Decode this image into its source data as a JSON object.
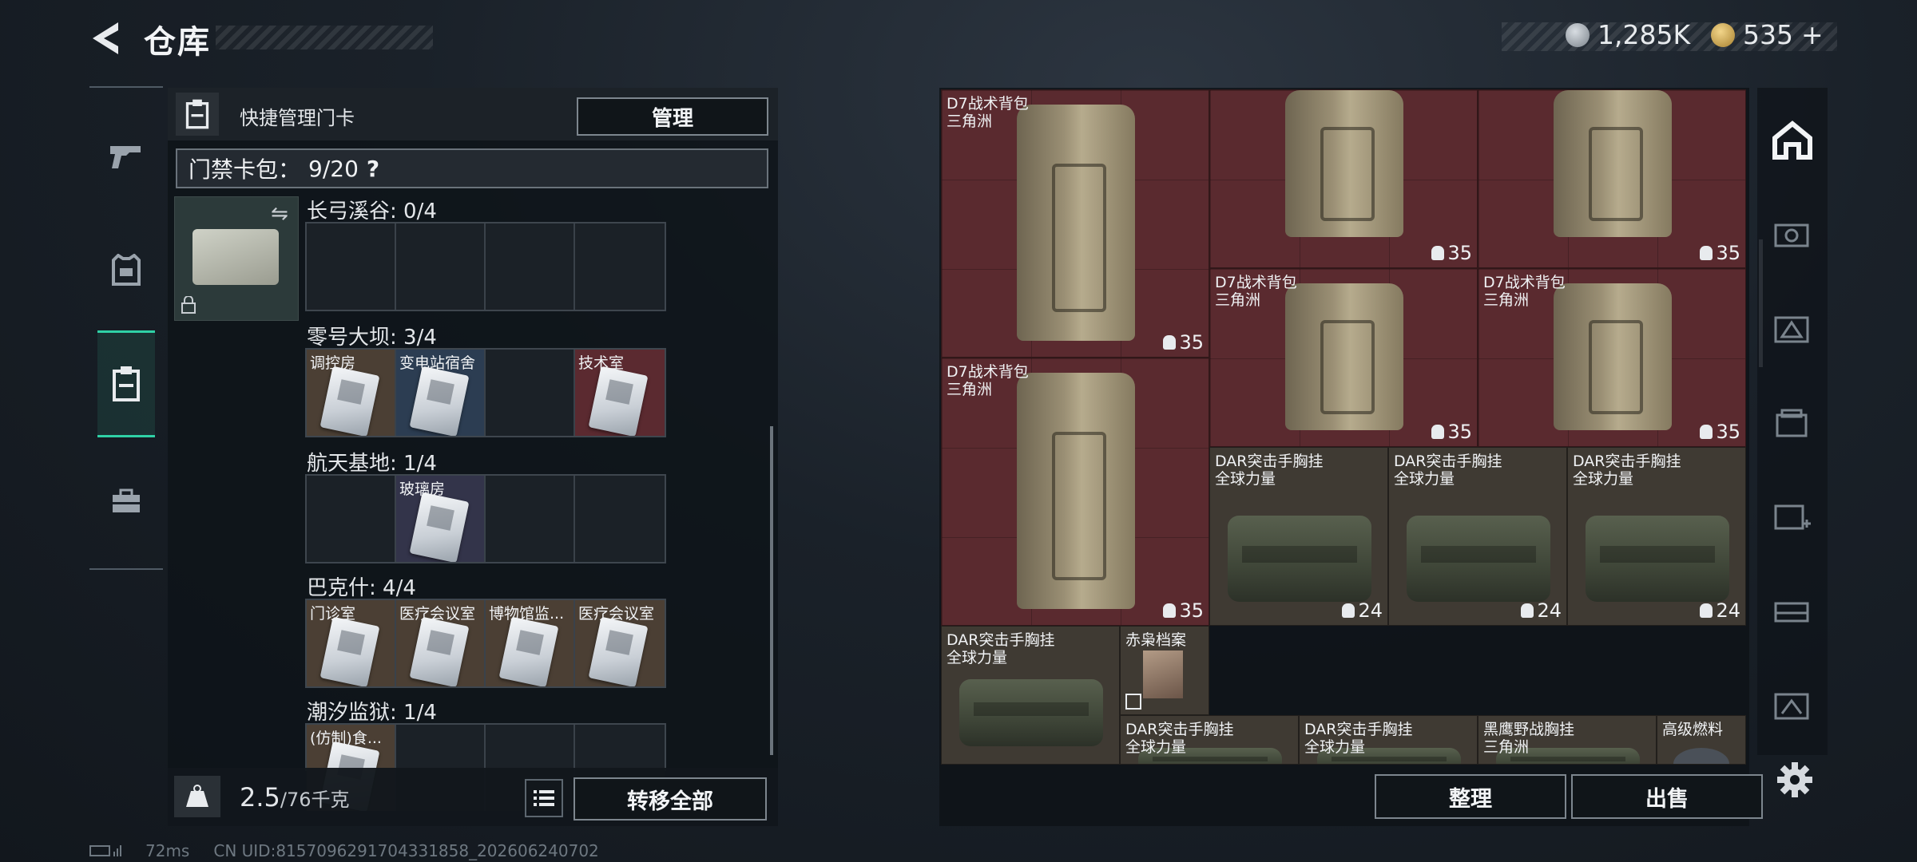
{
  "header": {
    "title": "仓库"
  },
  "currency": {
    "silver": "1,285K",
    "gold": "535",
    "gold_add": "+"
  },
  "left_nav": [
    "weapon-tab",
    "armor-tab",
    "keycard-tab",
    "toolbox-tab"
  ],
  "card_panel": {
    "quick_label": "快捷管理门卡",
    "manage_label": "管理",
    "keybag_label": "门禁卡包：",
    "keybag_count": "9/20",
    "keybag_help": "?",
    "maps": [
      {
        "title": "长弓溪谷: 0/4",
        "slots": [
          {
            "label": "",
            "color": "empty"
          },
          {
            "label": "",
            "color": "empty"
          },
          {
            "label": "",
            "color": "empty"
          },
          {
            "label": "",
            "color": "empty"
          }
        ]
      },
      {
        "title": "零号大坝: 3/4",
        "slots": [
          {
            "label": "调控房",
            "color": "beige"
          },
          {
            "label": "变电站宿舍",
            "color": "blue"
          },
          {
            "label": "",
            "color": "empty"
          },
          {
            "label": "技术室",
            "color": "red"
          }
        ]
      },
      {
        "title": "航天基地: 1/4",
        "slots": [
          {
            "label": "",
            "color": "empty"
          },
          {
            "label": "玻璃房",
            "color": "purple"
          },
          {
            "label": "",
            "color": "empty"
          },
          {
            "label": "",
            "color": "empty"
          }
        ]
      },
      {
        "title": "巴克什: 4/4",
        "slots": [
          {
            "label": "门诊室",
            "color": "beige"
          },
          {
            "label": "医疗会议室",
            "color": "beige"
          },
          {
            "label": "博物馆监...",
            "color": "beige"
          },
          {
            "label": "医疗会议室",
            "color": "beige"
          }
        ]
      },
      {
        "title": "潮汐监狱: 1/4",
        "slots": [
          {
            "label": "(仿制)食...",
            "color": "beige"
          },
          {
            "label": "",
            "color": "empty"
          },
          {
            "label": "",
            "color": "empty"
          },
          {
            "label": "",
            "color": "empty"
          }
        ]
      }
    ],
    "weight_value": "2.5",
    "weight_unit": "/76千克",
    "transfer_label": "转移全部"
  },
  "inventory": {
    "items": [
      {
        "name": "D7战术背包",
        "sub": "三角洲",
        "count": "35",
        "color": "red",
        "kind": "backpack",
        "show_name": true
      },
      {
        "name": "",
        "sub": "",
        "count": "35",
        "color": "red",
        "kind": "backpack",
        "show_name": false
      },
      {
        "name": "",
        "sub": "",
        "count": "35",
        "color": "red",
        "kind": "backpack",
        "show_name": false
      },
      {
        "name": "D7战术背包",
        "sub": "三角洲",
        "count": "35",
        "color": "red",
        "kind": "backpack",
        "show_name": true
      },
      {
        "name": "D7战术背包",
        "sub": "三角洲",
        "count": "35",
        "color": "red",
        "kind": "backpack",
        "show_name": true
      },
      {
        "name": "D7战术背包",
        "sub": "三角洲",
        "count": "35",
        "color": "red",
        "kind": "backpack",
        "show_name": true
      },
      {
        "name": "DAR突击手胸挂",
        "sub": "全球力量",
        "count": "24",
        "color": "beige",
        "kind": "rig",
        "show_name": true
      },
      {
        "name": "DAR突击手胸挂",
        "sub": "全球力量",
        "count": "24",
        "color": "beige",
        "kind": "rig",
        "show_name": true
      },
      {
        "name": "DAR突击手胸挂",
        "sub": "全球力量",
        "count": "24",
        "color": "beige",
        "kind": "rig",
        "show_name": true
      },
      {
        "name": "DAR突击手胸挂",
        "sub": "全球力量",
        "count": "",
        "color": "beige",
        "kind": "rig",
        "show_name": true
      },
      {
        "name": "赤枭档案",
        "sub": "",
        "count": "",
        "color": "beige",
        "kind": "doc",
        "show_name": true
      },
      {
        "name": "DAR突击手胸挂",
        "sub": "全球力量",
        "count": "",
        "color": "beige",
        "kind": "rig",
        "show_name": true
      },
      {
        "name": "DAR突击手胸挂",
        "sub": "全球力量",
        "count": "",
        "color": "beige",
        "kind": "rig",
        "show_name": true
      },
      {
        "name": "黑鹰野战胸挂",
        "sub": "三角洲",
        "count": "",
        "color": "beige",
        "kind": "rig",
        "show_name": true
      },
      {
        "name": "高级燃料",
        "sub": "",
        "count": "",
        "color": "beige",
        "kind": "fuel",
        "show_name": true
      }
    ],
    "sort_label": "整理",
    "sell_label": "出售"
  },
  "right_rail": [
    "home-icon",
    "attachment-slot-icon",
    "map-slot-icon",
    "box-slot-icon",
    "medical-slot-icon",
    "backpack-slot-icon",
    "rig-slot-icon"
  ],
  "status": {
    "ping": "72ms",
    "uid": "CN UID:8157096291704331858_202606240702"
  }
}
